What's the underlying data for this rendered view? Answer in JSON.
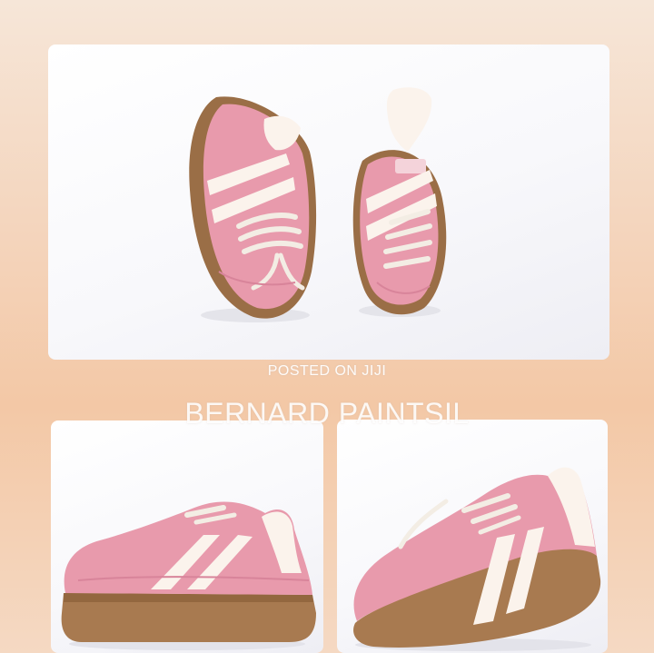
{
  "watermark": {
    "line1": "POSTED ON JIJI",
    "line2": "BERNARD PAINTSIL"
  },
  "colors": {
    "upper": "#e89aac",
    "upper_dark": "#d8849a",
    "stripe": "#fbf3ec",
    "sole": "#b0825a",
    "sole_dark": "#95683f",
    "lace": "#f3ede4",
    "background_peach": "#f3c8a6"
  },
  "images": [
    {
      "name": "top-photo",
      "subject": "pair of pink sneakers viewed from above"
    },
    {
      "name": "bottom-left-photo",
      "subject": "pink sneaker side view"
    },
    {
      "name": "bottom-right-photo",
      "subject": "pink sneaker three-quarter view"
    }
  ]
}
